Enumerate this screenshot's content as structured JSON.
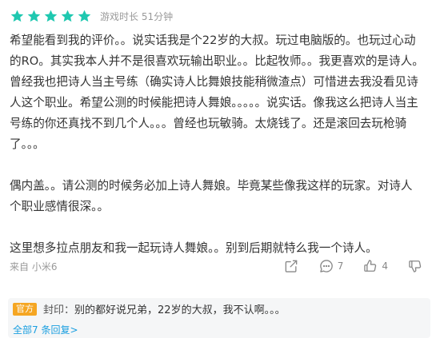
{
  "header": {
    "stars_filled": 5,
    "stars_total": 5,
    "star_color": "#1fc8b0",
    "playtime_label": "游戏时长 51分钟"
  },
  "review": {
    "paragraphs": [
      "希望能看到我的评价。。说实话我是个22岁的大叔。玩过电脑版的。也玩过心动的RO。其实我本人并不是很喜欢玩输出职业。。比起牧师。。我更喜欢的是诗人。曾经我也把诗人当主号练（确实诗人比舞娘技能稍微渣点）可惜进去我没看见诗人这个职业。希望公测的时候能把诗人舞娘。。。。。说实话。像我这么把诗人当主号练的你还真找不到几个人。。。曾经也玩敏骑。太烧钱了。还是滚回去玩枪骑了。。。",
      "偶内盖。。请公测的时候务必加上诗人舞娘。毕竟某些像我这样的玩家。对诗人个职业感情很深。。",
      "这里想多拉点朋友和我一起玩诗人舞娘。。别到后期就特么我一个诗人。"
    ]
  },
  "meta": {
    "source": "来自 小米6"
  },
  "actions": {
    "share_icon": "share-icon",
    "comment_icon": "comment-icon",
    "comment_count": "7",
    "like_icon": "thumbs-up-icon",
    "like_count": "4",
    "dislike_icon": "thumbs-down-icon"
  },
  "reply": {
    "tag": "官方",
    "tag_color": "#f5a623",
    "author": "封印",
    "separator": "：",
    "text": "别的都好说兄弟，22岁的大叔，我不认啊。。。",
    "all_replies_label": "全部7 条回复",
    "link_color": "#1a9fe0"
  }
}
